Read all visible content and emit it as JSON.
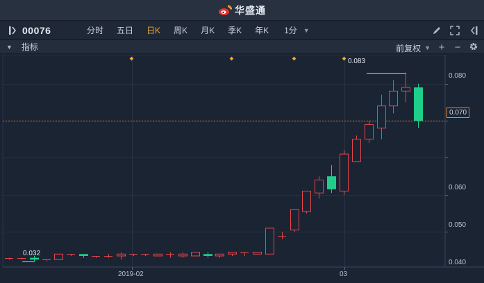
{
  "app": {
    "brand": "华盛通"
  },
  "toolbar": {
    "stock_code": "00076",
    "periods": [
      "分时",
      "五日",
      "日K",
      "周K",
      "月K",
      "季K",
      "年K"
    ],
    "active_period": "日K",
    "minute_select": "1分"
  },
  "indicator_bar": {
    "label": "指标",
    "adjust": "前复权"
  },
  "chart_data": {
    "type": "candlestick",
    "y_ticks": [
      "0.080",
      "0.070",
      "0.060",
      "0.050",
      "0.040"
    ],
    "x_labels": [
      "2019-02",
      "03"
    ],
    "current_price": "0.070",
    "high_label": "0.083",
    "low_label": "0.032",
    "ylim": [
      0.0305,
      0.0878
    ],
    "colors": {
      "up": "#e8454a",
      "down": "#1fce8a",
      "current_line": "#d8892f",
      "event_marker": "#f2a93b"
    },
    "candles": [
      {
        "o": 0.033,
        "h": 0.033,
        "l": 0.0325,
        "c": 0.033
      },
      {
        "o": 0.033,
        "h": 0.033,
        "l": 0.0325,
        "c": 0.033
      },
      {
        "o": 0.033,
        "h": 0.0335,
        "l": 0.032,
        "c": 0.0325
      },
      {
        "o": 0.0325,
        "h": 0.0325,
        "l": 0.032,
        "c": 0.0325
      },
      {
        "o": 0.0325,
        "h": 0.034,
        "l": 0.0325,
        "c": 0.034
      },
      {
        "o": 0.034,
        "h": 0.034,
        "l": 0.0335,
        "c": 0.034
      },
      {
        "o": 0.034,
        "h": 0.034,
        "l": 0.033,
        "c": 0.0335
      },
      {
        "o": 0.0335,
        "h": 0.0335,
        "l": 0.033,
        "c": 0.0335
      },
      {
        "o": 0.0335,
        "h": 0.034,
        "l": 0.033,
        "c": 0.0335
      },
      {
        "o": 0.0335,
        "h": 0.0345,
        "l": 0.0325,
        "c": 0.034
      },
      {
        "o": 0.034,
        "h": 0.034,
        "l": 0.0335,
        "c": 0.034
      },
      {
        "o": 0.034,
        "h": 0.034,
        "l": 0.0335,
        "c": 0.034
      },
      {
        "o": 0.0335,
        "h": 0.034,
        "l": 0.0335,
        "c": 0.034
      },
      {
        "o": 0.034,
        "h": 0.0345,
        "l": 0.033,
        "c": 0.034
      },
      {
        "o": 0.0335,
        "h": 0.0345,
        "l": 0.033,
        "c": 0.034
      },
      {
        "o": 0.0335,
        "h": 0.0345,
        "l": 0.0335,
        "c": 0.0345
      },
      {
        "o": 0.034,
        "h": 0.0345,
        "l": 0.033,
        "c": 0.0335
      },
      {
        "o": 0.0335,
        "h": 0.034,
        "l": 0.033,
        "c": 0.034
      },
      {
        "o": 0.034,
        "h": 0.0345,
        "l": 0.0335,
        "c": 0.0345
      },
      {
        "o": 0.0345,
        "h": 0.0345,
        "l": 0.0335,
        "c": 0.0345
      },
      {
        "o": 0.034,
        "h": 0.0345,
        "l": 0.034,
        "c": 0.0345
      },
      {
        "o": 0.034,
        "h": 0.041,
        "l": 0.034,
        "c": 0.041
      },
      {
        "o": 0.039,
        "h": 0.04,
        "l": 0.038,
        "c": 0.039
      },
      {
        "o": 0.0405,
        "h": 0.046,
        "l": 0.04,
        "c": 0.046
      },
      {
        "o": 0.0455,
        "h": 0.051,
        "l": 0.045,
        "c": 0.051
      },
      {
        "o": 0.0505,
        "h": 0.055,
        "l": 0.049,
        "c": 0.054
      },
      {
        "o": 0.055,
        "h": 0.058,
        "l": 0.0505,
        "c": 0.0515
      },
      {
        "o": 0.051,
        "h": 0.062,
        "l": 0.05,
        "c": 0.061
      },
      {
        "o": 0.059,
        "h": 0.066,
        "l": 0.059,
        "c": 0.065
      },
      {
        "o": 0.065,
        "h": 0.07,
        "l": 0.064,
        "c": 0.069
      },
      {
        "o": 0.068,
        "h": 0.077,
        "l": 0.065,
        "c": 0.074
      },
      {
        "o": 0.074,
        "h": 0.081,
        "l": 0.072,
        "c": 0.078
      },
      {
        "o": 0.078,
        "h": 0.083,
        "l": 0.075,
        "c": 0.079
      },
      {
        "o": 0.079,
        "h": 0.08,
        "l": 0.068,
        "c": 0.07
      }
    ]
  }
}
